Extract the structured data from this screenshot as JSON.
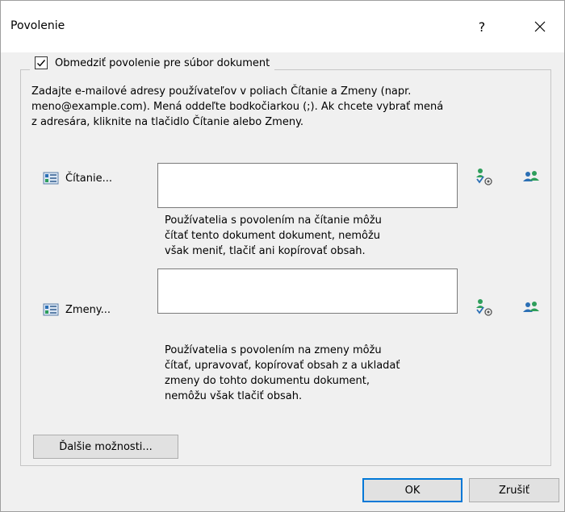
{
  "dialog": {
    "title": "Povolenie",
    "help_label": "?",
    "close_label": "Zavrieť"
  },
  "restrict": {
    "checked": true,
    "label": "Obmedziť povolenie pre súbor dokument"
  },
  "instructions": "Zadajte e-mailové adresy používateľov v poliach Čítanie a Zmeny (napr.\nmeno@example.com). Mená oddeľte bodkočiarkou (;). Ak chcete vybrať mená\nz adresára, kliknite na tlačidlo Čítanie alebo Zmeny.",
  "read": {
    "button_label": "Čítanie...",
    "value": "",
    "description": "Používatelia s povolením na čítanie môžu\nčítať tento dokument dokument, nemôžu\nvšak meniť, tlačiť ani kopírovať obsah."
  },
  "change": {
    "button_label": "Zmeny...",
    "value": "",
    "description": "Používatelia s povolením na zmeny môžu\nčítať, upravovať, kopírovať obsah z a ukladať\nzmeny do tohto dokumentu dokument,\nnemôžu však tlačiť obsah."
  },
  "buttons": {
    "more_options": "Ďalšie možnosti...",
    "ok": "OK",
    "cancel": "Zrušiť"
  },
  "icons": {
    "address_book": "address-book-icon",
    "check_names": "check-names-icon",
    "everyone": "add-everyone-icon"
  },
  "colors": {
    "accent": "#0078d7",
    "icon_green": "#2e9e5b",
    "icon_blue": "#2b6fb5"
  }
}
